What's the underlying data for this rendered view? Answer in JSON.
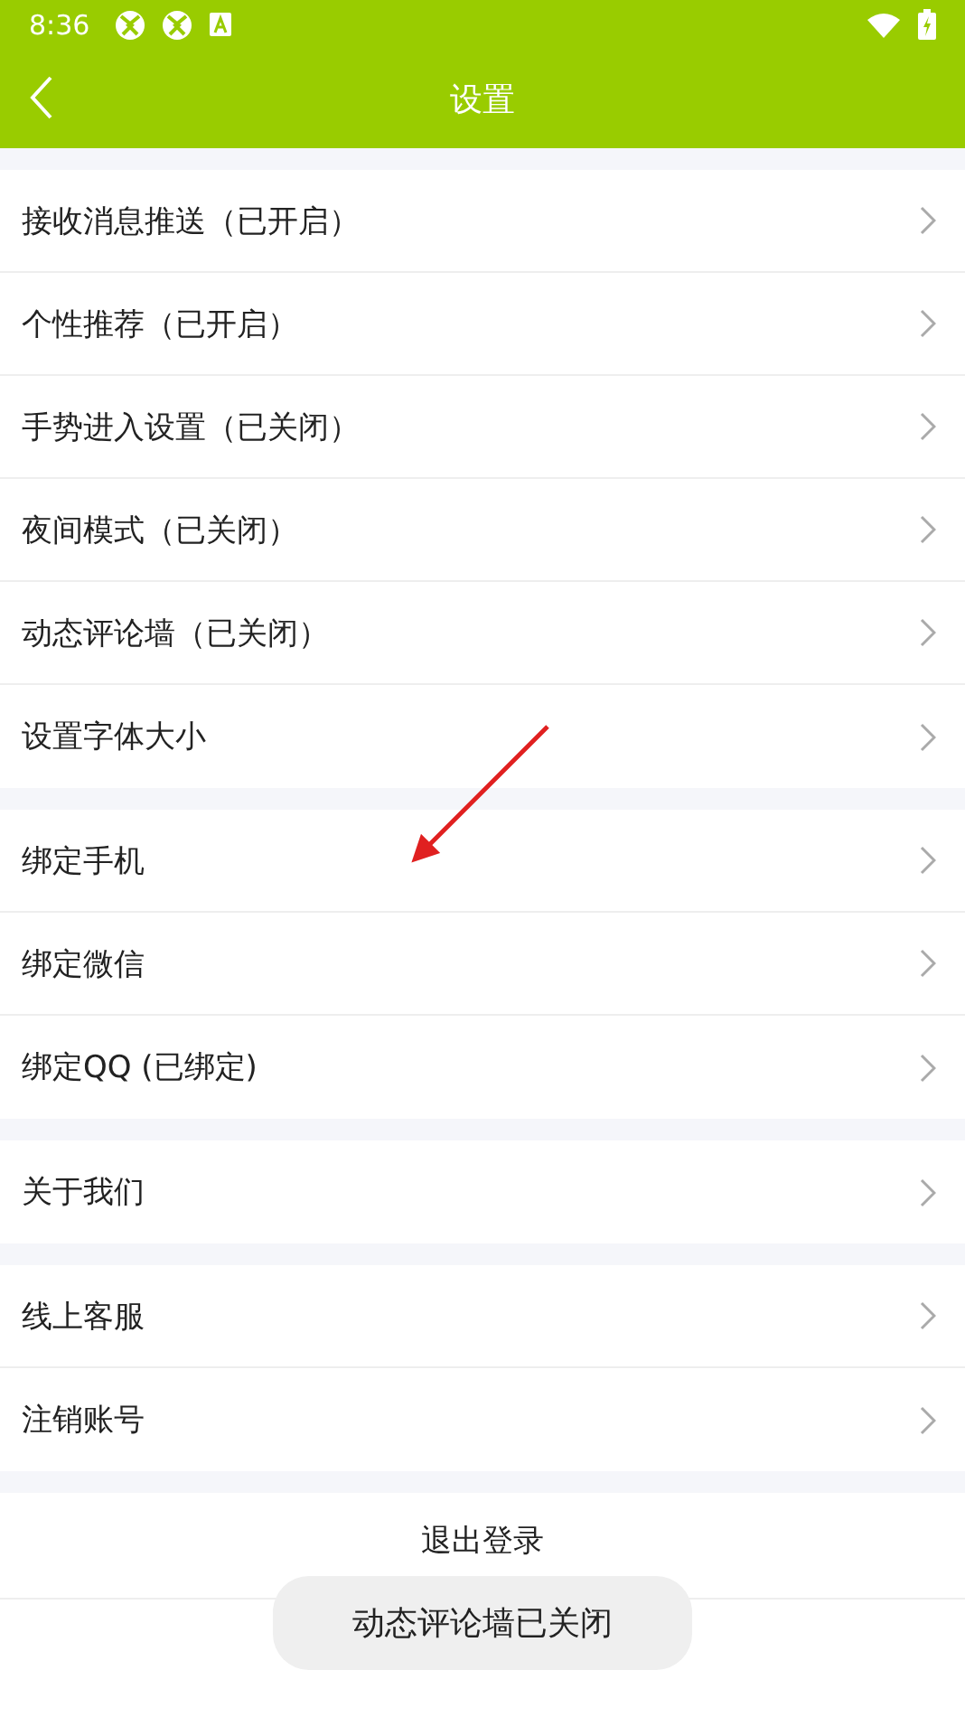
{
  "status_bar": {
    "time": "8:36"
  },
  "header": {
    "title": "设置"
  },
  "groups": [
    {
      "items": [
        {
          "label": "接收消息推送（已开启）"
        },
        {
          "label": "个性推荐（已开启）"
        },
        {
          "label": "手势进入设置（已关闭）"
        },
        {
          "label": "夜间模式（已关闭）"
        },
        {
          "label": "动态评论墙（已关闭）"
        },
        {
          "label": "设置字体大小"
        }
      ]
    },
    {
      "items": [
        {
          "label": "绑定手机"
        },
        {
          "label": "绑定微信"
        },
        {
          "label": "绑定QQ (已绑定)"
        }
      ]
    },
    {
      "items": [
        {
          "label": "关于我们"
        }
      ]
    },
    {
      "items": [
        {
          "label": "线上客服"
        },
        {
          "label": "注销账号"
        }
      ]
    }
  ],
  "logout_button": "退出登录",
  "toast": "动态评论墙已关闭"
}
